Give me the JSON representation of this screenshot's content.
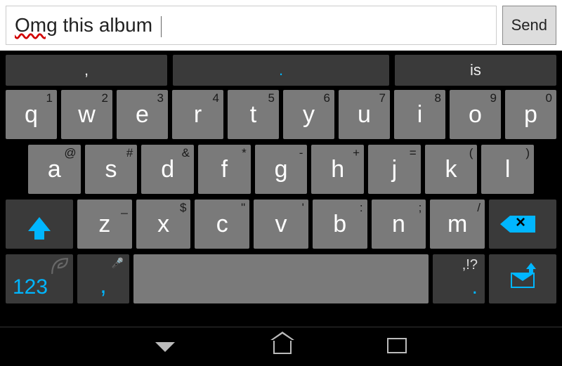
{
  "input": {
    "word1": "Omg",
    "rest": " this album ",
    "placeholder": ""
  },
  "send_label": "Send",
  "suggestions": {
    "left": ",",
    "center": ".",
    "right": "is"
  },
  "rows": {
    "r1": [
      {
        "main": "q",
        "sec": "1"
      },
      {
        "main": "w",
        "sec": "2"
      },
      {
        "main": "e",
        "sec": "3"
      },
      {
        "main": "r",
        "sec": "4"
      },
      {
        "main": "t",
        "sec": "5"
      },
      {
        "main": "y",
        "sec": "6"
      },
      {
        "main": "u",
        "sec": "7"
      },
      {
        "main": "i",
        "sec": "8"
      },
      {
        "main": "o",
        "sec": "9"
      },
      {
        "main": "p",
        "sec": "0"
      }
    ],
    "r2": [
      {
        "main": "a",
        "sec": "@"
      },
      {
        "main": "s",
        "sec": "#"
      },
      {
        "main": "d",
        "sec": "&"
      },
      {
        "main": "f",
        "sec": "*"
      },
      {
        "main": "g",
        "sec": "-"
      },
      {
        "main": "h",
        "sec": "+"
      },
      {
        "main": "j",
        "sec": "="
      },
      {
        "main": "k",
        "sec": "("
      },
      {
        "main": "l",
        "sec": ")"
      }
    ],
    "r3": [
      {
        "main": "z",
        "sec": "_"
      },
      {
        "main": "x",
        "sec": "$"
      },
      {
        "main": "c",
        "sec": "\""
      },
      {
        "main": "v",
        "sec": "'"
      },
      {
        "main": "b",
        "sec": ":"
      },
      {
        "main": "n",
        "sec": ";"
      },
      {
        "main": "m",
        "sec": "/"
      }
    ]
  },
  "bottom": {
    "num_label": "123",
    "comma": ",",
    "punct_top": ",!?",
    "punct_bot": "."
  }
}
